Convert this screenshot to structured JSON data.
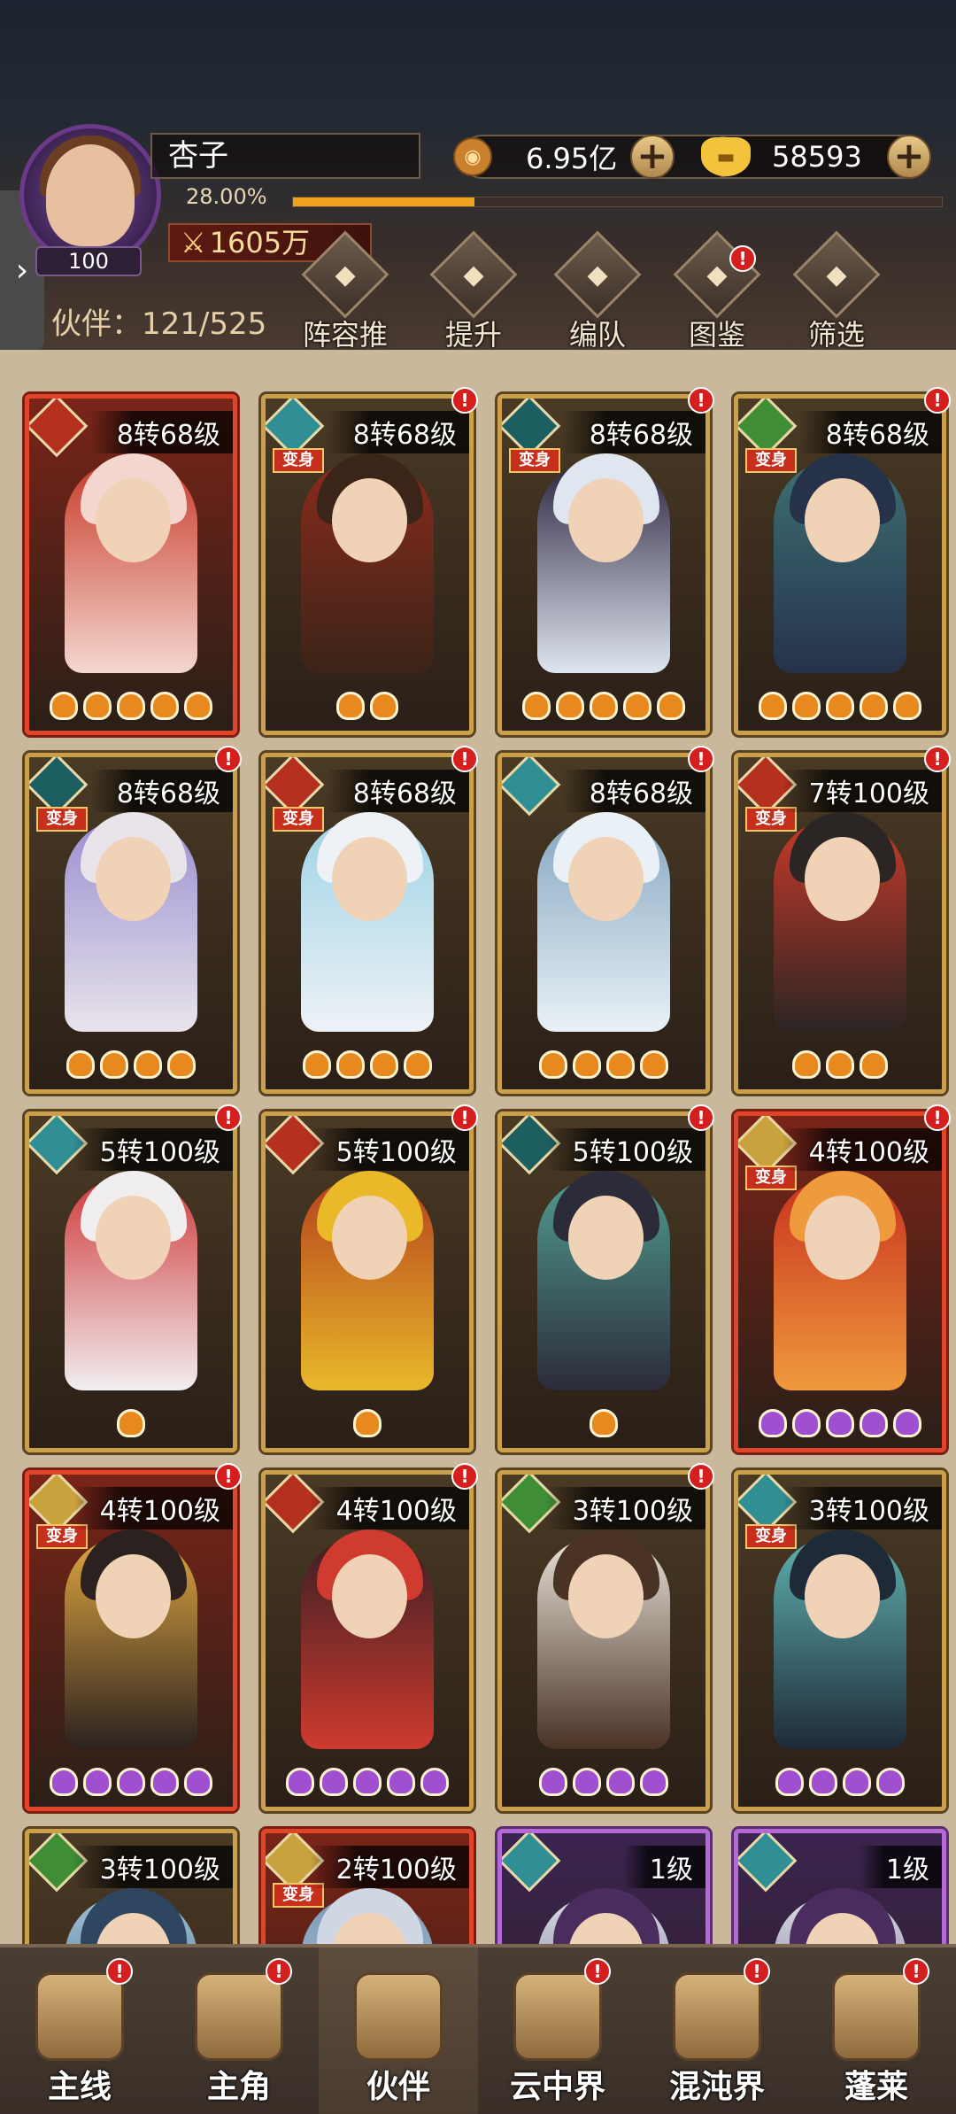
{
  "header": {
    "player_name": "杏子",
    "level": "100",
    "exp_percent": "28.00%",
    "exp_fraction": 0.28,
    "power": "1605万",
    "side_tab_icon": "chevron-right-icon",
    "coins": {
      "icon": "coin-icon",
      "value": "6.95亿"
    },
    "gold": {
      "icon": "gold-ingot-icon",
      "value": "58593"
    },
    "partner_count": "伙伴：121/525"
  },
  "toolbar": [
    {
      "label": "阵容推荐",
      "icon": "lineup-recommend-icon",
      "badge": false
    },
    {
      "label": "提升",
      "icon": "upgrade-icon",
      "badge": false
    },
    {
      "label": "编队",
      "icon": "formation-icon",
      "badge": false
    },
    {
      "label": "图鉴",
      "icon": "codex-icon",
      "badge": true
    },
    {
      "label": "筛选",
      "icon": "filter-icon",
      "badge": false
    }
  ],
  "cards": [
    {
      "level": "8转68级",
      "faction": "red-demon",
      "transform": "",
      "alert": false,
      "stars": 5,
      "star_color": "orange",
      "frame": "red",
      "palette": [
        "#f3d7cf",
        "#c93b2a"
      ]
    },
    {
      "level": "8转68级",
      "faction": "teal",
      "transform": "变身",
      "alert": true,
      "stars": 2,
      "star_color": "orange",
      "frame": "gold",
      "palette": [
        "#3b2418",
        "#8a2b1c"
      ]
    },
    {
      "level": "8转68级",
      "faction": "dark-teal",
      "transform": "变身",
      "alert": true,
      "stars": 5,
      "star_color": "orange",
      "frame": "gold",
      "palette": [
        "#dfe6ef",
        "#2b2440"
      ]
    },
    {
      "level": "8转68级",
      "faction": "green",
      "transform": "变身",
      "alert": true,
      "stars": 5,
      "star_color": "orange",
      "frame": "gold",
      "palette": [
        "#26324a",
        "#3d6f74"
      ]
    },
    {
      "level": "8转68级",
      "faction": "dark-teal",
      "transform": "变身",
      "alert": true,
      "stars": 4,
      "star_color": "orange",
      "frame": "gold",
      "palette": [
        "#e8e4ea",
        "#9b8fd2"
      ]
    },
    {
      "level": "8转68级",
      "faction": "red-demon",
      "transform": "变身",
      "alert": true,
      "stars": 4,
      "star_color": "orange",
      "frame": "gold",
      "palette": [
        "#eef2f6",
        "#9fd3e6"
      ]
    },
    {
      "level": "8转68级",
      "faction": "teal",
      "transform": "",
      "alert": true,
      "stars": 4,
      "star_color": "orange",
      "frame": "gold",
      "palette": [
        "#e9f1f6",
        "#87a8c2"
      ]
    },
    {
      "level": "7转100级",
      "faction": "red-demon",
      "transform": "变身",
      "alert": true,
      "stars": 3,
      "star_color": "orange",
      "frame": "gold",
      "palette": [
        "#2b2523",
        "#c63a2a"
      ]
    },
    {
      "level": "5转100级",
      "faction": "teal",
      "transform": "",
      "alert": true,
      "stars": 1,
      "star_color": "orange",
      "frame": "gold",
      "palette": [
        "#f1eef0",
        "#cf3b3b"
      ]
    },
    {
      "level": "5转100级",
      "faction": "red-demon",
      "transform": "",
      "alert": true,
      "stars": 1,
      "star_color": "orange",
      "frame": "gold",
      "palette": [
        "#e9b92a",
        "#b5421d"
      ]
    },
    {
      "level": "5转100级",
      "faction": "dark-teal",
      "transform": "",
      "alert": true,
      "stars": 1,
      "star_color": "orange",
      "frame": "gold",
      "palette": [
        "#2c2b3a",
        "#4f9b8f"
      ]
    },
    {
      "level": "4转100级",
      "faction": "gold",
      "transform": "变身",
      "alert": true,
      "stars": 5,
      "star_color": "purple",
      "frame": "red",
      "palette": [
        "#ef9a3d",
        "#c8321e"
      ]
    },
    {
      "level": "4转100级",
      "faction": "gold",
      "transform": "变身",
      "alert": true,
      "stars": 5,
      "star_color": "purple",
      "frame": "red",
      "palette": [
        "#2b2220",
        "#e0a640"
      ]
    },
    {
      "level": "4转100级",
      "faction": "red-demon",
      "transform": "",
      "alert": true,
      "stars": 5,
      "star_color": "purple",
      "frame": "gold",
      "palette": [
        "#cf3b2e",
        "#3a1e24"
      ]
    },
    {
      "level": "3转100级",
      "faction": "green",
      "transform": "",
      "alert": true,
      "stars": 4,
      "star_color": "purple",
      "frame": "gold",
      "palette": [
        "#4a3225",
        "#e7e2d8"
      ]
    },
    {
      "level": "3转100级",
      "faction": "teal",
      "transform": "变身",
      "alert": false,
      "stars": 4,
      "star_color": "purple",
      "frame": "gold",
      "palette": [
        "#1f2a38",
        "#5fb0b0"
      ]
    },
    {
      "level": "3转100级",
      "faction": "green",
      "transform": "",
      "alert": false,
      "stars": 0,
      "star_color": "purple",
      "frame": "gold",
      "palette": [
        "#2e4660",
        "#9fc2d8"
      ]
    },
    {
      "level": "2转100级",
      "faction": "gold",
      "transform": "变身",
      "alert": false,
      "stars": 0,
      "star_color": "purple",
      "frame": "red",
      "palette": [
        "#cfd7e3",
        "#7a9bb8"
      ]
    },
    {
      "level": "1级",
      "faction": "teal",
      "transform": "",
      "alert": false,
      "stars": 0,
      "star_color": "purple",
      "frame": "purple",
      "palette": [
        "#4b2c5e",
        "#d7dfe6"
      ]
    },
    {
      "level": "1级",
      "faction": "teal",
      "transform": "",
      "alert": false,
      "stars": 0,
      "star_color": "purple",
      "frame": "purple",
      "palette": [
        "#4b2c5e",
        "#d7dfe6"
      ]
    }
  ],
  "colors": {
    "red-demon": "#b5301f",
    "teal": "#2f8f94",
    "dark-teal": "#1d5f60",
    "green": "#3f8d35",
    "gold": "#caa23d"
  },
  "bottom_nav": [
    {
      "label": "主线",
      "icon": "main-quest-icon",
      "badge": true,
      "active": false
    },
    {
      "label": "主角",
      "icon": "hero-icon",
      "badge": true,
      "active": false
    },
    {
      "label": "伙伴",
      "icon": "partner-icon",
      "badge": false,
      "active": true
    },
    {
      "label": "云中界",
      "icon": "cloud-realm-icon",
      "badge": true,
      "active": false
    },
    {
      "label": "混沌界",
      "icon": "chaos-realm-icon",
      "badge": true,
      "active": false
    },
    {
      "label": "蓬莱",
      "icon": "penglai-icon",
      "badge": true,
      "active": false
    }
  ]
}
